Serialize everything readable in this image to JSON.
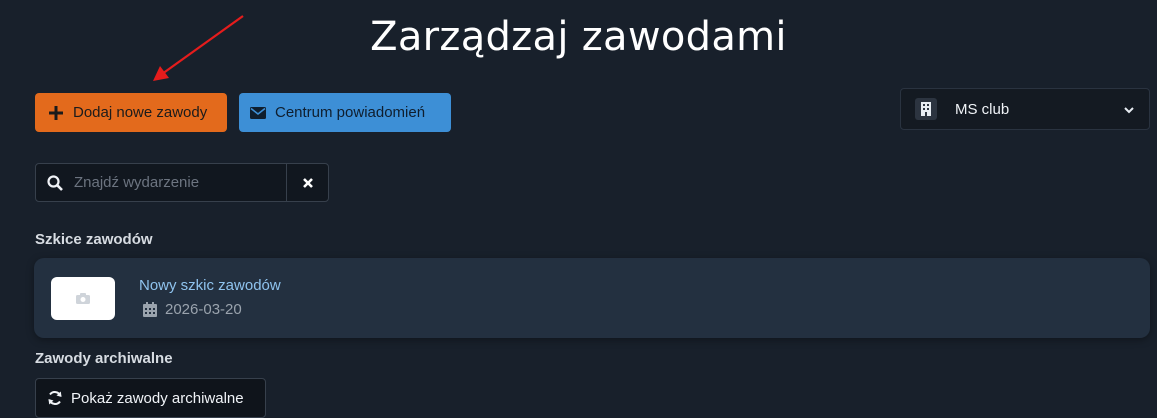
{
  "header": {
    "title": "Zarządzaj zawodami"
  },
  "toolbar": {
    "add_label": "Dodaj nowe zawody",
    "add_icon": "plus-icon",
    "notify_label": "Centrum powiadomień",
    "notify_icon": "envelope-icon",
    "add_color": "#e36a1c",
    "notify_color": "#3d8fd6"
  },
  "club_select": {
    "selected": "MS club",
    "icon": "building-icon"
  },
  "search": {
    "placeholder": "Znajdź wydarzenie",
    "value": ""
  },
  "drafts": {
    "heading": "Szkice zawodów",
    "items": [
      {
        "name": "Nowy szkic zawodów",
        "date": "2026-03-20"
      }
    ]
  },
  "archive": {
    "heading": "Zawody archiwalne",
    "button_label": "Pokaż zawody archiwalne"
  }
}
